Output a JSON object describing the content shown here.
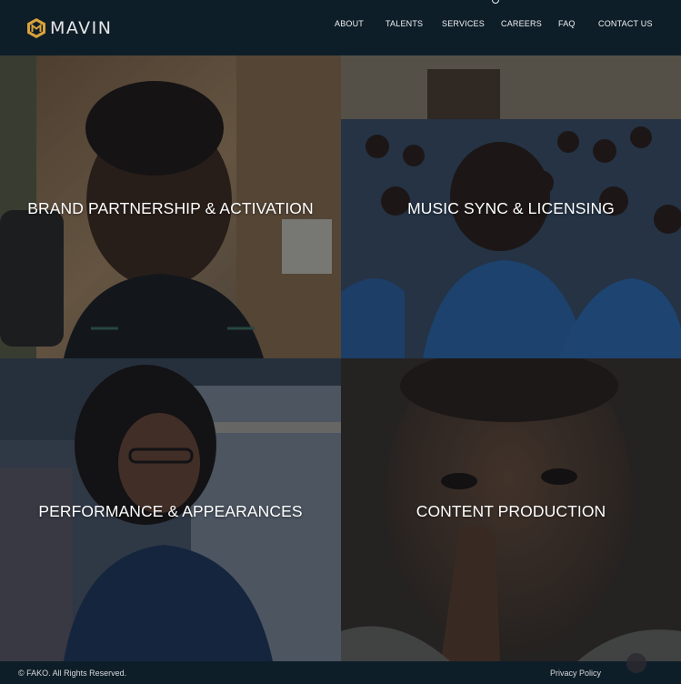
{
  "brand": {
    "name": "MAVIN",
    "accent": "#d9a23a"
  },
  "nav": {
    "items": [
      "ABOUT",
      "TALENTS",
      "SERVICES",
      "CAREERS",
      "FAQ",
      "CONTACT US"
    ]
  },
  "services": {
    "tiles": [
      {
        "label": "BRAND PARTNERSHIP & ACTIVATION"
      },
      {
        "label": "MUSIC SYNC & LICENSING"
      },
      {
        "label": "PERFORMANCE & APPEARANCES"
      },
      {
        "label": "CONTENT PRODUCTION"
      }
    ]
  },
  "footer": {
    "copyright": "© FAKO. All Rights Reserved.",
    "privacy": "Privacy Policy"
  },
  "colors": {
    "header_bg": "#0e1e29",
    "text": "#ffffff"
  }
}
